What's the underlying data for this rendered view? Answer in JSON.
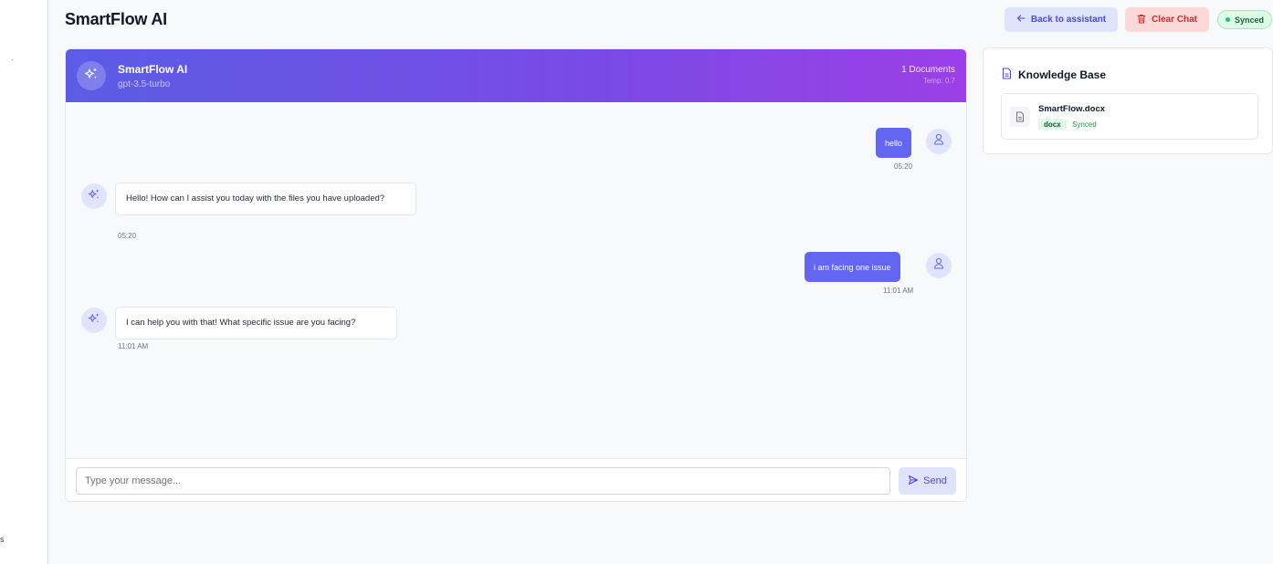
{
  "app": {
    "title": "SmartFlow AI"
  },
  "sidebar": {
    "frag_top": ".",
    "frag_bottom": "s"
  },
  "toolbar": {
    "back_label": "Back to assistant",
    "clear_label": "Clear Chat",
    "status_label": "Synced"
  },
  "chat": {
    "assistant_name": "SmartFlow AI",
    "model": "gpt-3.5-turbo",
    "documents": "1 Documents",
    "temperature": "Temp: 0.7",
    "messages": [
      {
        "role": "user",
        "text": "hello",
        "time": "05:20"
      },
      {
        "role": "assistant",
        "text": "Hello! How can I assist you today with the files you have uploaded?",
        "time": "05:20"
      },
      {
        "role": "user",
        "text": "i am facing one issue",
        "time": "11:01 AM"
      },
      {
        "role": "assistant",
        "text": "I can help you with that! What specific issue are you facing?",
        "time": "11:01 AM"
      }
    ],
    "input_placeholder": "Type your message...",
    "input_value": "",
    "send_label": "Send"
  },
  "knowledge_base": {
    "title": "Knowledge Base",
    "files": [
      {
        "name": "SmartFlow.docx",
        "type": "docx",
        "status": "Synced"
      }
    ]
  },
  "colors": {
    "accent": "#6366f1",
    "header_start": "#5b5ce6",
    "header_end": "#9c3fe8",
    "danger": "#dc2626",
    "success": "#22c55e"
  }
}
